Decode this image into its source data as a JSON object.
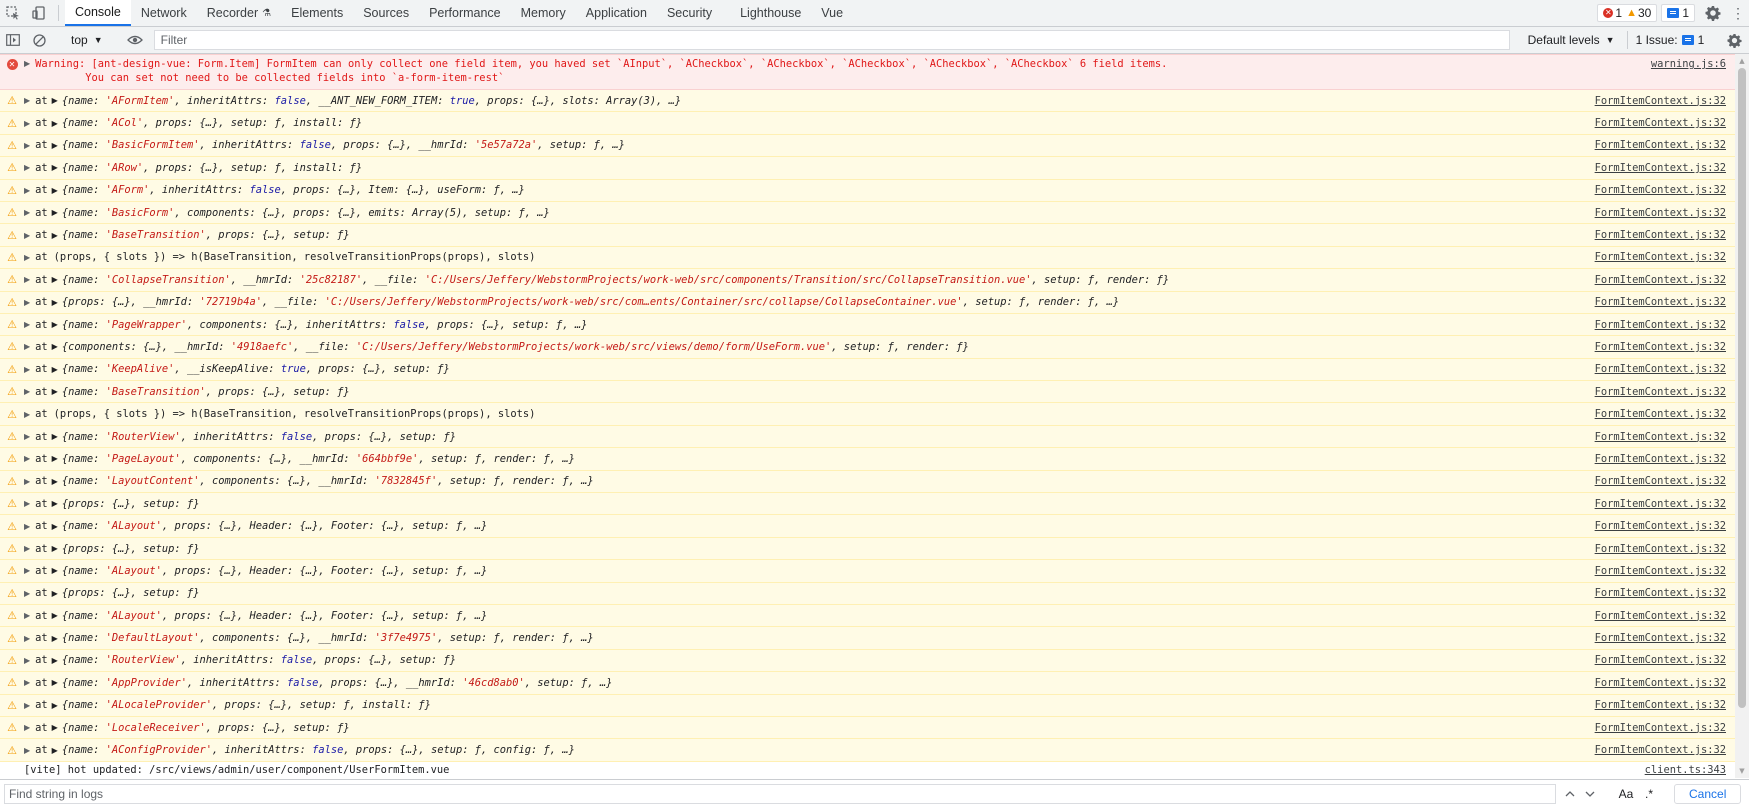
{
  "tabs": [
    {
      "label": "Console",
      "active": true
    },
    {
      "label": "Network"
    },
    {
      "label": "Recorder"
    },
    {
      "label": "Elements"
    },
    {
      "label": "Sources"
    },
    {
      "label": "Performance"
    },
    {
      "label": "Memory"
    },
    {
      "label": "Application"
    },
    {
      "label": "Security"
    },
    {
      "label": "Lighthouse"
    },
    {
      "label": "Vue"
    }
  ],
  "counters": {
    "errors": "1",
    "warnings": "30",
    "issues": "1"
  },
  "toolbar": {
    "context": "top",
    "filter_placeholder": "Filter",
    "levels": "Default levels",
    "issues_label": "1 Issue:",
    "issues_count": "1"
  },
  "error": {
    "line1": "Warning: [ant-design-vue: Form.Item] FormItem can only collect one field item, you haved set `AInput`, `ACheckbox`, `ACheckbox`, `ACheckbox`, `ACheckbox`, `ACheckbox` 6 field items.",
    "line2": "        You can set not need to be collected fields into `a-form-item-rest`",
    "source": "warning.js:6"
  },
  "warnings": [
    {
      "at": "at",
      "text": "{name: 'AFormItem', inheritAttrs: false, __ANT_NEW_FORM_ITEM: true, props: {…}, slots: Array(3), …}",
      "source": "FormItemContext.js:32"
    },
    {
      "at": "at",
      "text": "{name: 'ACol', props: {…}, setup: ƒ, install: ƒ}",
      "source": "FormItemContext.js:32"
    },
    {
      "at": "at",
      "text": "{name: 'BasicFormItem', inheritAttrs: false, props: {…}, __hmrId: '5e57a72a', setup: ƒ, …}",
      "source": "FormItemContext.js:32"
    },
    {
      "at": "at",
      "text": "{name: 'ARow', props: {…}, setup: ƒ, install: ƒ}",
      "source": "FormItemContext.js:32"
    },
    {
      "at": "at",
      "text": "{name: 'AForm', inheritAttrs: false, props: {…}, Item: {…}, useForm: ƒ, …}",
      "source": "FormItemContext.js:32"
    },
    {
      "at": "at",
      "text": "{name: 'BasicForm', components: {…}, props: {…}, emits: Array(5), setup: ƒ, …}",
      "source": "FormItemContext.js:32"
    },
    {
      "at": "at",
      "text": "{name: 'BaseTransition', props: {…}, setup: ƒ}",
      "source": "FormItemContext.js:32"
    },
    {
      "at": "at",
      "text": "(props, { slots }) => h(BaseTransition, resolveTransitionProps(props), slots)",
      "plain": true,
      "source": "FormItemContext.js:32"
    },
    {
      "at": "at",
      "text": "{name: 'CollapseTransition', __hmrId: '25c82187', __file: 'C:/Users/Jeffery/WebstormProjects/work-web/src/components/Transition/src/CollapseTransition.vue', setup: ƒ, render: ƒ}",
      "source": "FormItemContext.js:32"
    },
    {
      "at": "at",
      "text": "{props: {…}, __hmrId: '72719b4a', __file: 'C:/Users/Jeffery/WebstormProjects/work-web/src/com…ents/Container/src/collapse/CollapseContainer.vue', setup: ƒ, render: ƒ, …}",
      "source": "FormItemContext.js:32"
    },
    {
      "at": "at",
      "text": "{name: 'PageWrapper', components: {…}, inheritAttrs: false, props: {…}, setup: ƒ, …}",
      "source": "FormItemContext.js:32"
    },
    {
      "at": "at",
      "text": "{components: {…}, __hmrId: '4918aefc', __file: 'C:/Users/Jeffery/WebstormProjects/work-web/src/views/demo/form/UseForm.vue', setup: ƒ, render: ƒ}",
      "source": "FormItemContext.js:32"
    },
    {
      "at": "at",
      "text": "{name: 'KeepAlive', __isKeepAlive: true, props: {…}, setup: ƒ}",
      "source": "FormItemContext.js:32"
    },
    {
      "at": "at",
      "text": "{name: 'BaseTransition', props: {…}, setup: ƒ}",
      "source": "FormItemContext.js:32"
    },
    {
      "at": "at",
      "text": "(props, { slots }) => h(BaseTransition, resolveTransitionProps(props), slots)",
      "plain": true,
      "source": "FormItemContext.js:32"
    },
    {
      "at": "at",
      "text": "{name: 'RouterView', inheritAttrs: false, props: {…}, setup: ƒ}",
      "source": "FormItemContext.js:32"
    },
    {
      "at": "at",
      "text": "{name: 'PageLayout', components: {…}, __hmrId: '664bbf9e', setup: ƒ, render: ƒ, …}",
      "source": "FormItemContext.js:32"
    },
    {
      "at": "at",
      "text": "{name: 'LayoutContent', components: {…}, __hmrId: '7832845f', setup: ƒ, render: ƒ, …}",
      "source": "FormItemContext.js:32"
    },
    {
      "at": "at",
      "text": "{props: {…}, setup: ƒ}",
      "source": "FormItemContext.js:32"
    },
    {
      "at": "at",
      "text": "{name: 'ALayout', props: {…}, Header: {…}, Footer: {…}, setup: ƒ, …}",
      "source": "FormItemContext.js:32"
    },
    {
      "at": "at",
      "text": "{props: {…}, setup: ƒ}",
      "source": "FormItemContext.js:32"
    },
    {
      "at": "at",
      "text": "{name: 'ALayout', props: {…}, Header: {…}, Footer: {…}, setup: ƒ, …}",
      "source": "FormItemContext.js:32"
    },
    {
      "at": "at",
      "text": "{props: {…}, setup: ƒ}",
      "source": "FormItemContext.js:32"
    },
    {
      "at": "at",
      "text": "{name: 'ALayout', props: {…}, Header: {…}, Footer: {…}, setup: ƒ, …}",
      "source": "FormItemContext.js:32"
    },
    {
      "at": "at",
      "text": "{name: 'DefaultLayout', components: {…}, __hmrId: '3f7e4975', setup: ƒ, render: ƒ, …}",
      "source": "FormItemContext.js:32"
    },
    {
      "at": "at",
      "text": "{name: 'RouterView', inheritAttrs: false, props: {…}, setup: ƒ}",
      "source": "FormItemContext.js:32"
    },
    {
      "at": "at",
      "text": "{name: 'AppProvider', inheritAttrs: false, props: {…}, __hmrId: '46cd8ab0', setup: ƒ, …}",
      "source": "FormItemContext.js:32"
    },
    {
      "at": "at",
      "text": "{name: 'ALocaleProvider', props: {…}, setup: ƒ, install: ƒ}",
      "source": "FormItemContext.js:32"
    },
    {
      "at": "at",
      "text": "{name: 'LocaleReceiver', props: {…}, setup: ƒ}",
      "source": "FormItemContext.js:32"
    },
    {
      "at": "at",
      "text": "{name: 'AConfigProvider', inheritAttrs: false, props: {…}, setup: ƒ, config: ƒ, …}",
      "source": "FormItemContext.js:32"
    }
  ],
  "info": {
    "text": "[vite] hot updated: /src/views/admin/user/component/UserFormItem.vue",
    "source": "client.ts:343"
  },
  "findbar": {
    "placeholder": "Find string in logs",
    "match_case": "Aa",
    "regex": ".*",
    "cancel": "Cancel"
  }
}
